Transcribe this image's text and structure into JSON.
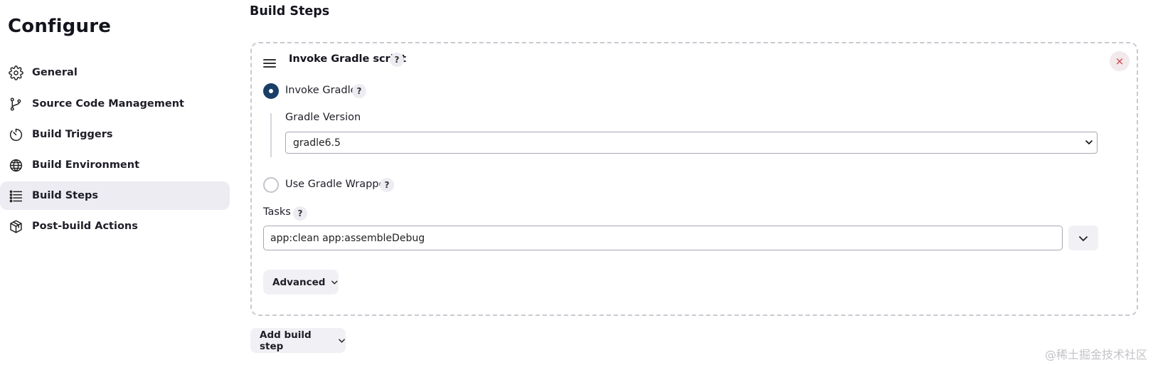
{
  "sidebar": {
    "title": "Configure",
    "items": [
      {
        "label": "General",
        "icon": "gear-icon",
        "active": false
      },
      {
        "label": "Source Code Management",
        "icon": "branch-icon",
        "active": false
      },
      {
        "label": "Build Triggers",
        "icon": "timer-icon",
        "active": false
      },
      {
        "label": "Build Environment",
        "icon": "globe-icon",
        "active": false
      },
      {
        "label": "Build Steps",
        "icon": "list-icon",
        "active": true
      },
      {
        "label": "Post-build Actions",
        "icon": "package-icon",
        "active": false
      }
    ]
  },
  "main": {
    "section_title": "Build Steps",
    "step": {
      "title": "Invoke Gradle script",
      "help": "?",
      "close": "×",
      "options": [
        {
          "label": "Invoke Gradle",
          "selected": true
        },
        {
          "label": "Use Gradle Wrapper",
          "selected": false
        }
      ],
      "gradle_version_label": "Gradle Version",
      "gradle_version_value": "gradle6.5",
      "tasks_label": "Tasks",
      "tasks_value": "app:clean app:assembleDebug",
      "advanced_label": "Advanced"
    },
    "add_build_step_label": "Add build step"
  },
  "watermark": "@稀土掘金技术社区",
  "colors": {
    "active_nav_bg": "#ececf2",
    "radio_selected": "#1a3f66",
    "close_red": "#d23c4a"
  }
}
